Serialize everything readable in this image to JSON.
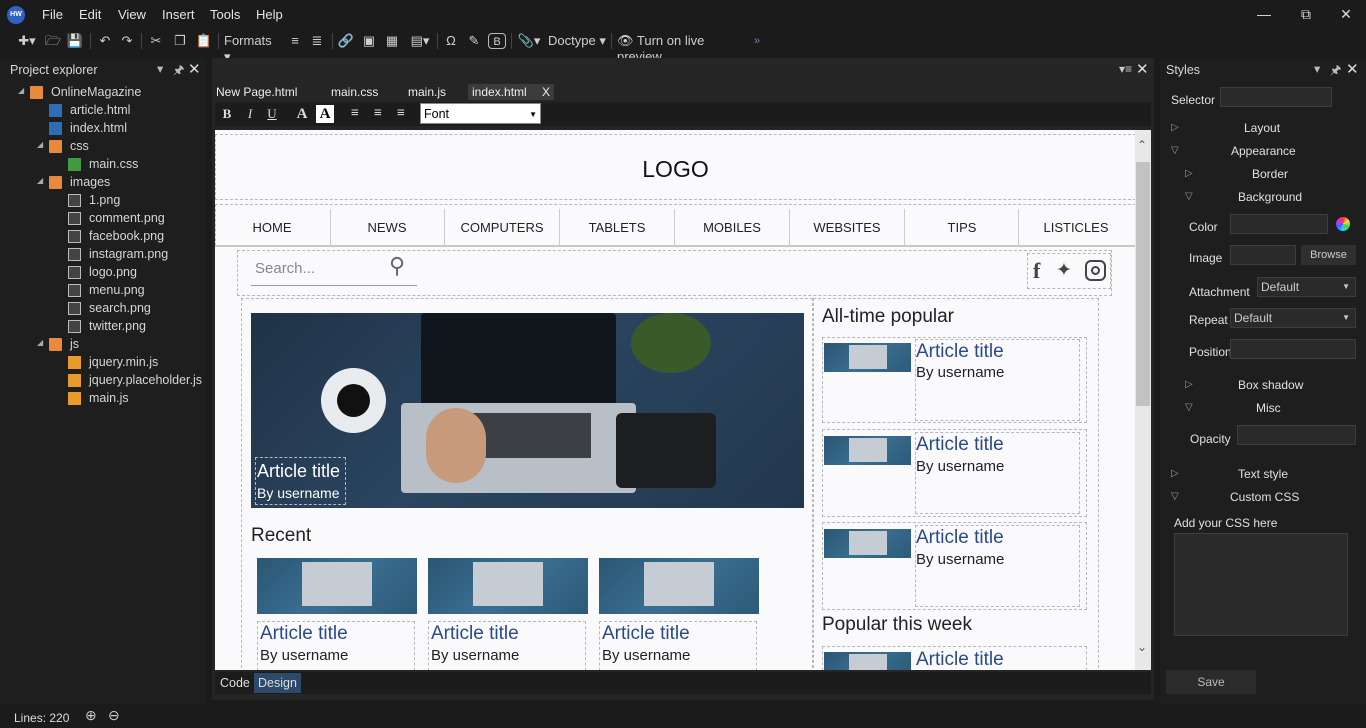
{
  "menu": [
    "File",
    "Edit",
    "View",
    "Insert",
    "Tools",
    "Help"
  ],
  "toolbar": {
    "formats": "Formats",
    "doctype": "Doctype",
    "live_preview": "Turn on live preview"
  },
  "project": {
    "title": "Project explorer",
    "root": "OnlineMagazine",
    "root_files": [
      "article.html",
      "index.html"
    ],
    "css_folder": "css",
    "css_files": [
      "main.css"
    ],
    "images_folder": "images",
    "images": [
      "1.png",
      "comment.png",
      "facebook.png",
      "instagram.png",
      "logo.png",
      "menu.png",
      "search.png",
      "twitter.png"
    ],
    "js_folder": "js",
    "js_files": [
      "jquery.min.js",
      "jquery.placeholder.js",
      "main.js"
    ]
  },
  "tabs": [
    "New Page.html",
    "main.css",
    "main.js",
    "index.html"
  ],
  "tab_close": "X",
  "format_bar": {
    "bold": "B",
    "italic": "I",
    "underline": "U",
    "font": "Font"
  },
  "page": {
    "logo": "LOGO",
    "nav": [
      "HOME",
      "NEWS",
      "COMPUTERS",
      "TABLETS",
      "MOBILES",
      "WEBSITES",
      "TIPS",
      "LISTICLES"
    ],
    "search_placeholder": "Search...",
    "hero_title": "Article title",
    "hero_user": "By username",
    "recent": "Recent",
    "recent_items": [
      {
        "title": "Article title",
        "user": "By username"
      },
      {
        "title": "Article title",
        "user": "By username"
      },
      {
        "title": "Article title",
        "user": "By username"
      }
    ],
    "popular": "All-time popular",
    "popular_items": [
      {
        "title": "Article title",
        "user": "By username"
      },
      {
        "title": "Article title",
        "user": "By username"
      },
      {
        "title": "Article title",
        "user": "By username"
      }
    ],
    "week": "Popular this week",
    "week_items": [
      {
        "title": "Article title"
      }
    ]
  },
  "modes": {
    "code": "Code",
    "design": "Design"
  },
  "styles": {
    "title": "Styles",
    "selector": "Selector",
    "layout": "Layout",
    "appearance": "Appearance",
    "border": "Border",
    "background": "Background",
    "color": "Color",
    "image": "Image",
    "browse": "Browse",
    "attachment": "Attachment",
    "attachment_value": "Default",
    "repeat": "Repeat",
    "repeat_value": "Default",
    "position": "Position",
    "box_shadow": "Box shadow",
    "misc": "Misc",
    "opacity": "Opacity",
    "text_style": "Text style",
    "custom_css": "Custom CSS",
    "add_css": "Add your CSS here",
    "save": "Save"
  },
  "status": {
    "lines": "Lines: 220"
  }
}
